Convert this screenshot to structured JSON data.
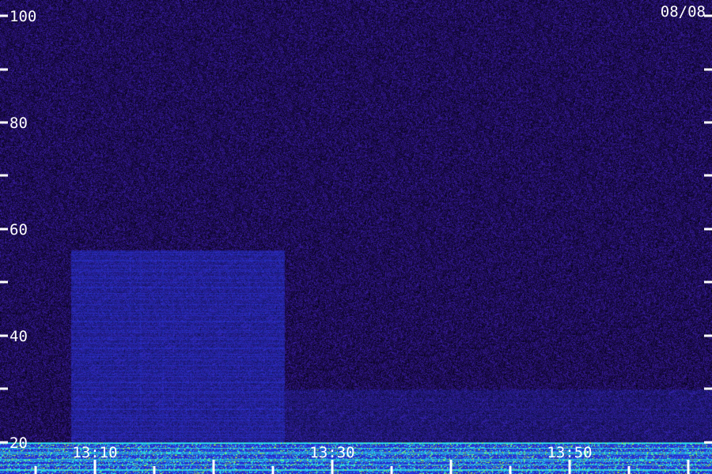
{
  "date_label": "08/08",
  "colors": {
    "background": "#1a0a4a",
    "noise_primary": "#3a1fa8",
    "band_blue": "#2a3cf0",
    "signal_cyan": "#28d8e6",
    "signal_green": "#a6ef3a",
    "tick": "#ffffff"
  },
  "chart_data": {
    "type": "heatmap",
    "title": "",
    "xlabel": "",
    "ylabel": "",
    "x_ticks": [
      "13:10",
      "13:30",
      "13:50"
    ],
    "x_range": [
      "13:02",
      "14:02"
    ],
    "y_ticks": [
      20,
      40,
      60,
      80,
      100
    ],
    "ylim": [
      14,
      103
    ],
    "grid": false,
    "bands": [
      {
        "name": "",
        "x_start": "13:08",
        "x_end": "13:26",
        "y_low": 20,
        "y_high": 56,
        "level": 0.55
      },
      {
        "name": "",
        "x_start": "13:26",
        "x_end": "14:02",
        "y_low": 20,
        "y_high": 30,
        "level": 0.25
      },
      {
        "name": "",
        "x_start": "13:02",
        "x_end": "14:02",
        "y_low": 14,
        "y_high": 20,
        "level": 0.9
      }
    ]
  }
}
